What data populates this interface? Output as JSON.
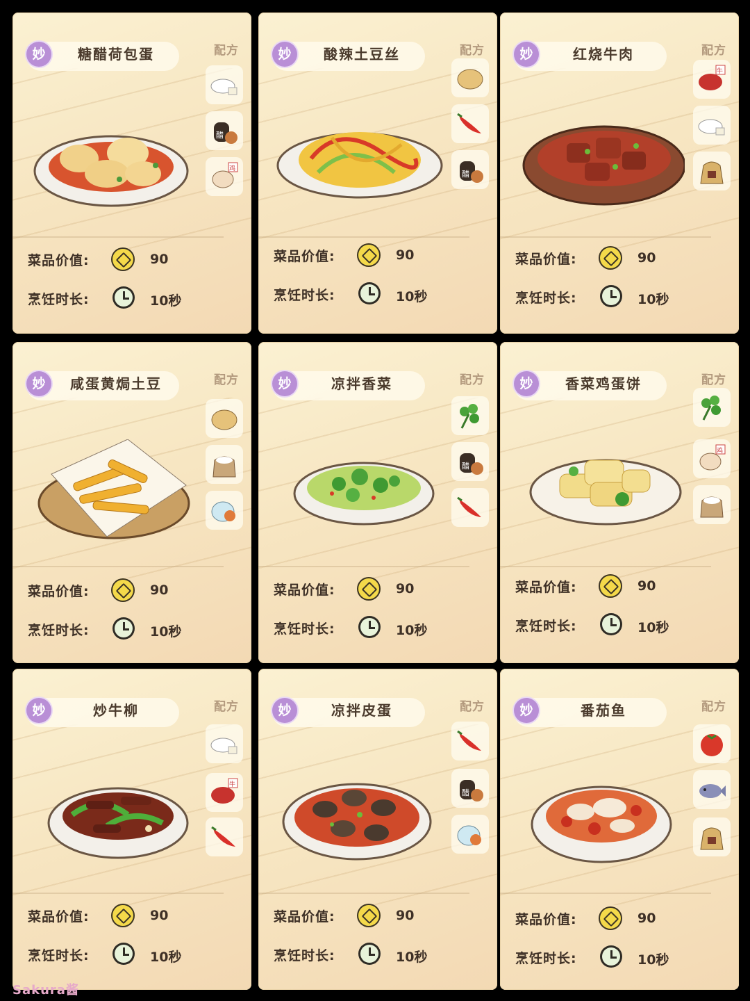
{
  "labels": {
    "recipe": "配方",
    "value": "菜品价值:",
    "time": "烹饪时长:",
    "badge": "妙"
  },
  "dishes": [
    {
      "name": "糖醋荷包蛋",
      "value": "90",
      "time": "10秒",
      "ingredients": [
        "flour-icon",
        "vinegar-jar-icon",
        "egg-icon"
      ]
    },
    {
      "name": "酸辣土豆丝",
      "value": "90",
      "time": "10秒",
      "ingredients": [
        "potato-icon",
        "chili-icon",
        "vinegar-jar-icon"
      ]
    },
    {
      "name": "红烧牛肉",
      "value": "90",
      "time": "10秒",
      "ingredients": [
        "beef-icon",
        "flour-icon",
        "seasoning-bag-icon"
      ]
    },
    {
      "name": "咸蛋黄焗土豆",
      "value": "90",
      "time": "10秒",
      "ingredients": [
        "potato-icon",
        "flour-sack-icon",
        "salted-egg-icon"
      ]
    },
    {
      "name": "凉拌香菜",
      "value": "90",
      "time": "10秒",
      "ingredients": [
        "cilantro-icon",
        "vinegar-jar-icon",
        "chili-icon"
      ]
    },
    {
      "name": "香菜鸡蛋饼",
      "value": "90",
      "time": "10秒",
      "ingredients": [
        "cilantro-icon",
        "egg-icon",
        "flour-sack-icon"
      ]
    },
    {
      "name": "炒牛柳",
      "value": "90",
      "time": "10秒",
      "ingredients": [
        "flour-icon",
        "beef-icon",
        "chili-icon"
      ]
    },
    {
      "name": "凉拌皮蛋",
      "value": "90",
      "time": "10秒",
      "ingredients": [
        "chili-icon",
        "vinegar-jar-icon",
        "salted-egg-icon"
      ]
    },
    {
      "name": "番茄鱼",
      "value": "90",
      "time": "10秒",
      "ingredients": [
        "tomato-icon",
        "fish-icon",
        "seasoning-bag-icon"
      ]
    }
  ],
  "watermark": "Sakura酱"
}
